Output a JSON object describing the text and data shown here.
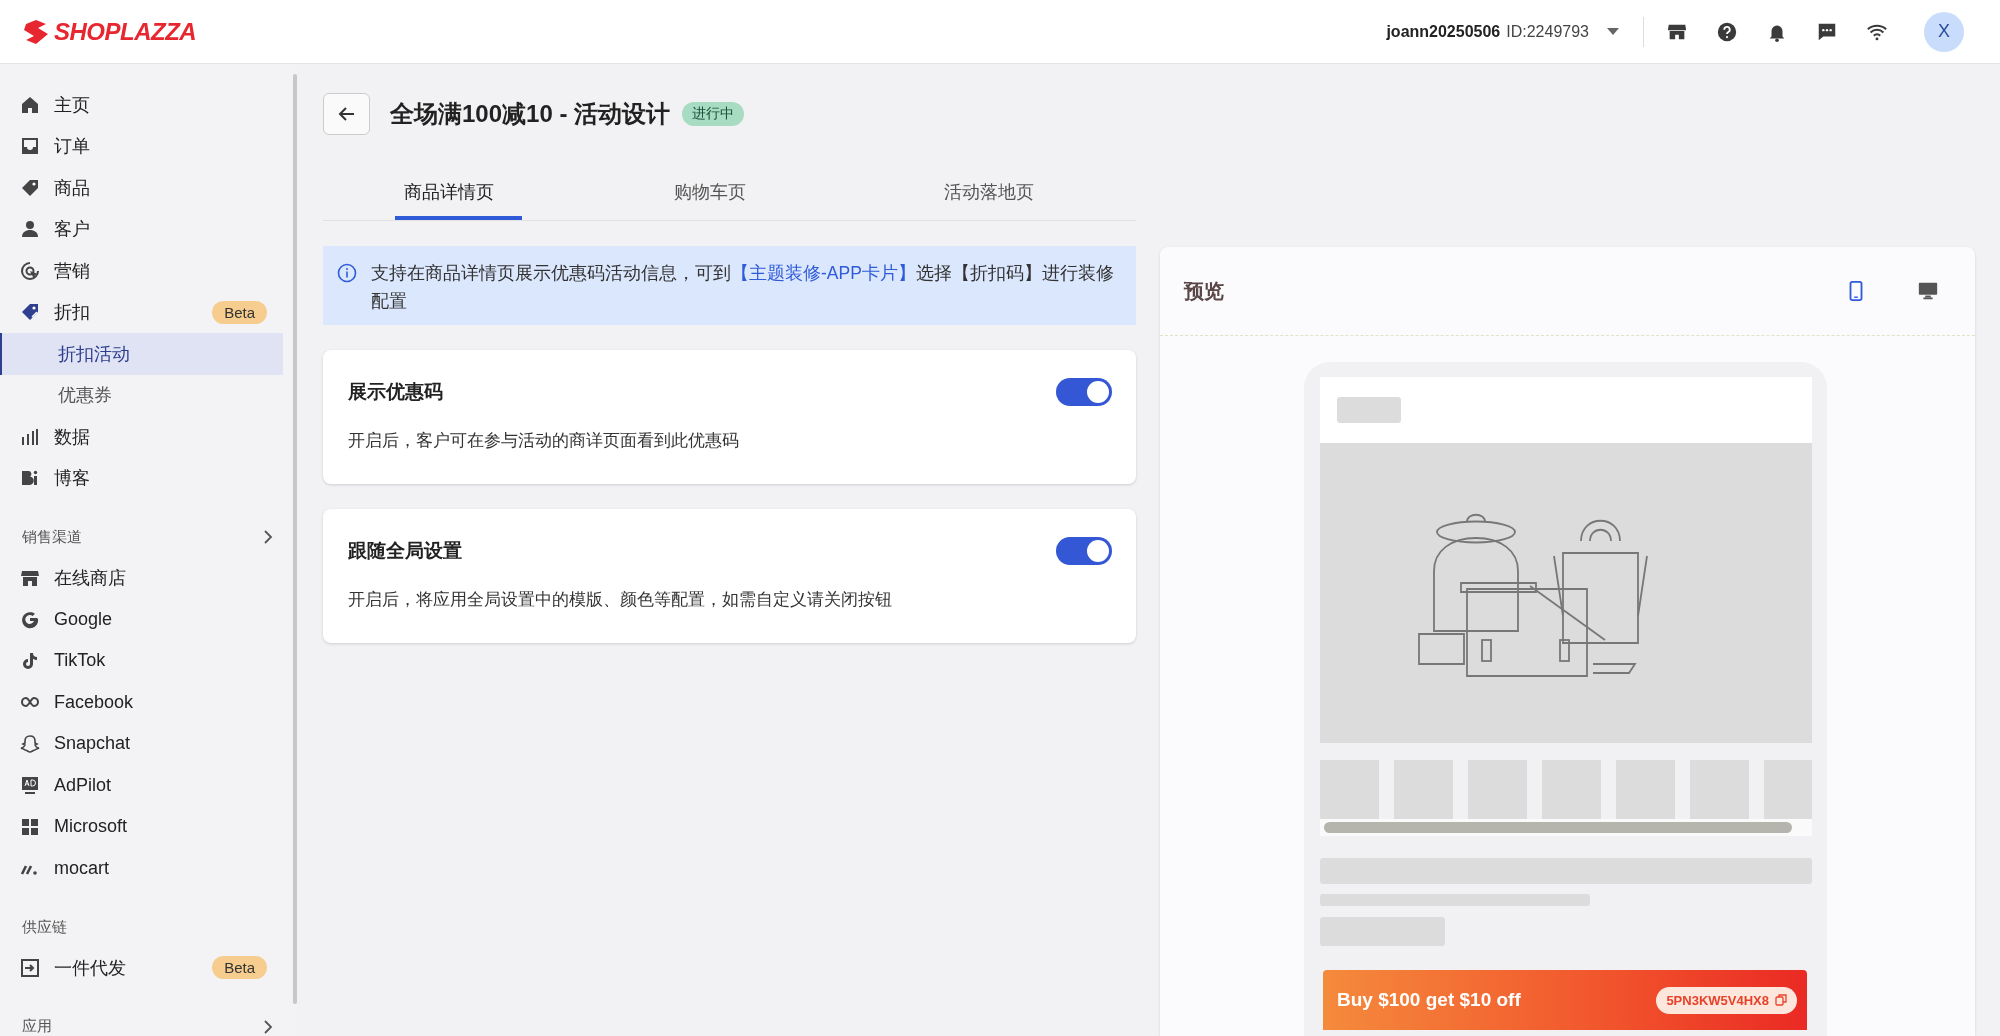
{
  "header": {
    "logo": "SHOPLAZZA",
    "account": "joann20250506",
    "account_id": "ID:2249793",
    "avatar": "X"
  },
  "sidebar": {
    "items": [
      {
        "kind": "item",
        "label": "主页",
        "selected": false
      },
      {
        "kind": "item",
        "label": "订单",
        "selected": false
      },
      {
        "kind": "item",
        "label": "商品",
        "selected": false
      },
      {
        "kind": "item",
        "label": "客户",
        "selected": false
      },
      {
        "kind": "item",
        "label": "营销",
        "selected": false
      },
      {
        "kind": "item",
        "label": "折扣",
        "selected": false,
        "badge": "Beta",
        "expanded": true,
        "children": [
          {
            "label": "折扣活动",
            "selected": true
          },
          {
            "label": "优惠券",
            "selected": false
          }
        ]
      },
      {
        "kind": "item",
        "label": "数据",
        "selected": false
      },
      {
        "kind": "item",
        "label": "博客",
        "selected": false
      },
      {
        "kind": "heading",
        "label": "销售渠道",
        "chevron": true
      },
      {
        "kind": "item",
        "label": "在线商店",
        "selected": false
      },
      {
        "kind": "item",
        "label": "Google",
        "selected": false
      },
      {
        "kind": "item",
        "label": "TikTok",
        "selected": false
      },
      {
        "kind": "item",
        "label": "Facebook",
        "selected": false
      },
      {
        "kind": "item",
        "label": "Snapchat",
        "selected": false
      },
      {
        "kind": "item",
        "label": "AdPilot",
        "selected": false
      },
      {
        "kind": "item",
        "label": "Microsoft",
        "selected": false
      },
      {
        "kind": "item",
        "label": "mocart",
        "selected": false
      },
      {
        "kind": "heading",
        "label": "供应链",
        "chevron": false
      },
      {
        "kind": "item",
        "label": "一件代发",
        "selected": false,
        "badge": "Beta"
      },
      {
        "kind": "heading",
        "label": "应用",
        "chevron": true
      }
    ]
  },
  "page": {
    "title": "全场满100减10 - 活动设计",
    "status": "进行中"
  },
  "tabs": [
    {
      "label": "商品详情页",
      "selected": true
    },
    {
      "label": "购物车页",
      "selected": false
    },
    {
      "label": "活动落地页",
      "selected": false
    }
  ],
  "notice": {
    "before": "支持在商品详情页展示优惠码活动信息，可到",
    "link": "【主题装修-APP卡片】",
    "after": "选择【折扣码】进行装修配置"
  },
  "settings": [
    {
      "title": "展示优惠码",
      "description": "开启后，客户可在参与活动的商详页面看到此优惠码",
      "on": true
    },
    {
      "title": "跟随全局设置",
      "description": "开启后，将应用全局设置中的模版、颜色等配置，如需自定义请关闭按钮",
      "on": true
    }
  ],
  "preview": {
    "title": "预览",
    "devices": [
      {
        "kind": "mobile",
        "selected": true
      },
      {
        "kind": "desktop",
        "selected": false
      }
    ],
    "coupon": {
      "text": "Buy $100 get $10 off",
      "code": "5PN3KW5V4HX8"
    }
  }
}
